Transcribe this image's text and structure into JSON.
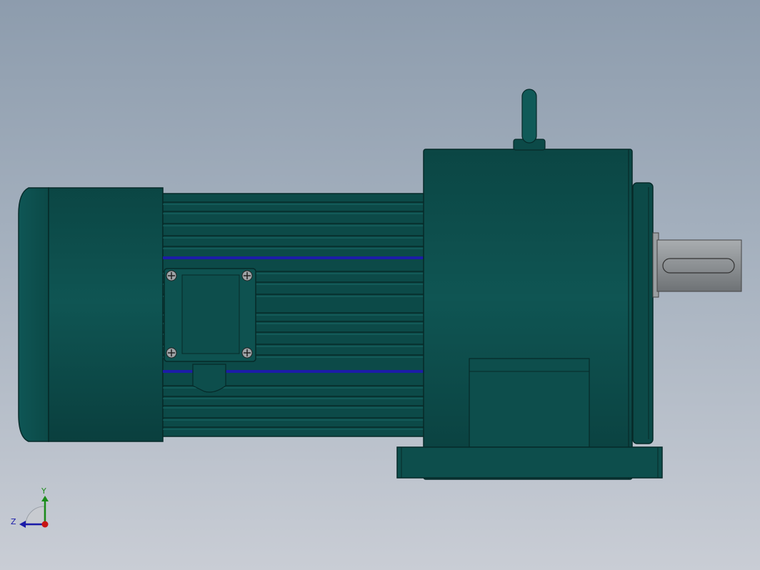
{
  "viewport": {
    "background_top": "#8d9cad",
    "background_bottom": "#c9cdd5",
    "model_color": "#0d4c4a",
    "model_edge_color": "#062a29",
    "shaft_color": "#8f9396",
    "stripe_color": "#1c1ca8"
  },
  "triad": {
    "y_label": "Y",
    "z_label": "Z",
    "y_color": "#1a8c1a",
    "z_color": "#1a1aa8",
    "x_color": "#c81414"
  }
}
